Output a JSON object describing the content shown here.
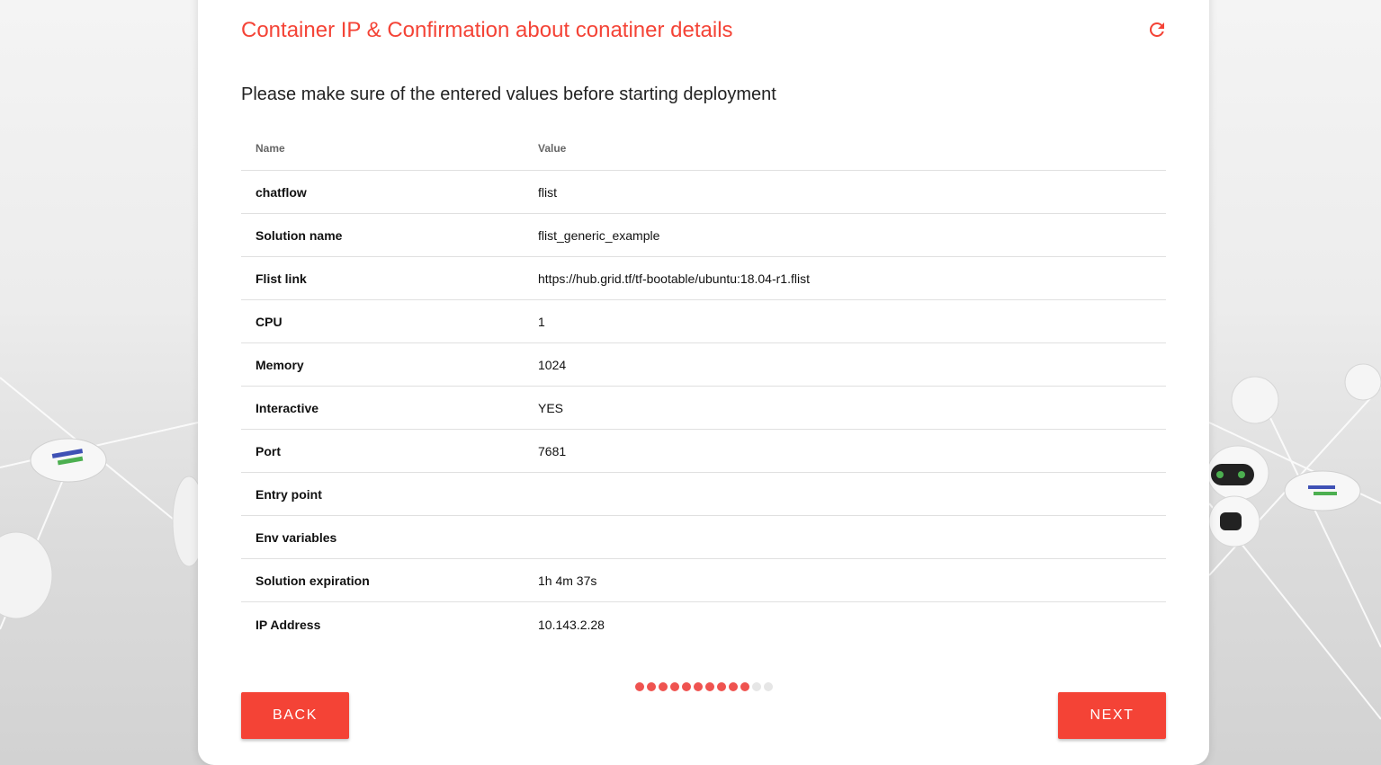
{
  "dialog": {
    "title": "Container IP & Confirmation about conatiner details",
    "subtitle": "Please make sure of the entered values before starting deployment",
    "refresh_icon": "refresh-icon"
  },
  "table": {
    "headers": {
      "name": "Name",
      "value": "Value"
    },
    "rows": [
      {
        "name": "chatflow",
        "value": "flist"
      },
      {
        "name": "Solution name",
        "value": "flist_generic_example"
      },
      {
        "name": "Flist link",
        "value": "https://hub.grid.tf/tf-bootable/ubuntu:18.04-r1.flist"
      },
      {
        "name": "CPU",
        "value": "1"
      },
      {
        "name": "Memory",
        "value": "1024"
      },
      {
        "name": "Interactive",
        "value": "YES"
      },
      {
        "name": "Port",
        "value": "7681"
      },
      {
        "name": "Entry point",
        "value": ""
      },
      {
        "name": "Env variables",
        "value": ""
      },
      {
        "name": "Solution expiration",
        "value": "1h 4m 37s"
      },
      {
        "name": "IP Address",
        "value": "10.143.2.28"
      }
    ]
  },
  "progress": {
    "completed_steps": 10,
    "total_steps": 12
  },
  "buttons": {
    "back": "BACK",
    "next": "NEXT"
  },
  "colors": {
    "accent": "#f44336",
    "progress_done": "#ef5350",
    "progress_todo": "#e6e6e6"
  }
}
